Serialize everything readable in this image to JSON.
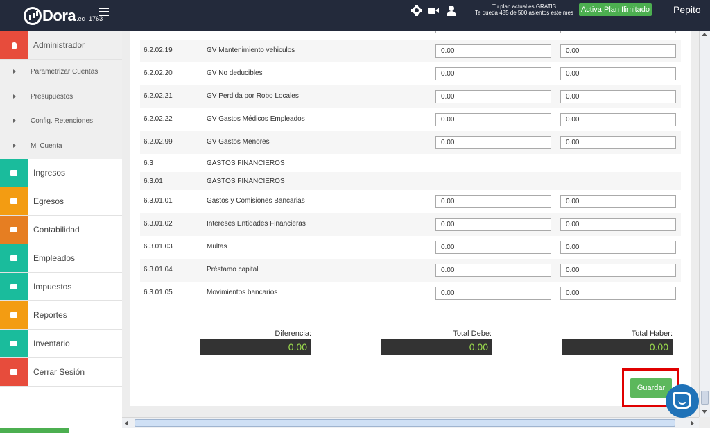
{
  "header": {
    "logo_text": "Dora",
    "logo_suffix": ".ec",
    "logo_number": "1763",
    "plan_line1": "Tu plan actual es GRATIS",
    "plan_line2": "Te queda 485 de 500 asientos este mes",
    "plan_button": "Activa Plan Ilimitado",
    "username": "Pepito"
  },
  "sidebar": {
    "admin_label": "Administrador",
    "admin_color": "#e74c3c",
    "subitems": [
      "Parametrizar Cuentas",
      "Presupuestos",
      "Config. Retenciones",
      "Mi Cuenta"
    ],
    "items": [
      {
        "label": "Ingresos",
        "color": "#1abc9c",
        "icon": "money-icon"
      },
      {
        "label": "Egresos",
        "color": "#f39c12",
        "icon": "sign-out-icon"
      },
      {
        "label": "Contabilidad",
        "color": "#e67e22",
        "icon": "briefcase-icon"
      },
      {
        "label": "Empleados",
        "color": "#1abc9c",
        "icon": "users-icon"
      },
      {
        "label": "Impuestos",
        "color": "#1abc9c",
        "icon": "balance-icon"
      },
      {
        "label": "Reportes",
        "color": "#f39c12",
        "icon": "chart-icon"
      },
      {
        "label": "Inventario",
        "color": "#1abc9c",
        "icon": "box-icon"
      },
      {
        "label": "Cerrar Sesión",
        "color": "#e74c3c",
        "icon": "power-icon"
      }
    ]
  },
  "rows": [
    {
      "code": "6.2.02.19",
      "name": "GV Mantenimiento vehiculos",
      "debe": "0.00",
      "haber": "0.00",
      "alt": true,
      "section": false
    },
    {
      "code": "6.2.02.20",
      "name": "GV No deducibles",
      "debe": "0.00",
      "haber": "0.00",
      "alt": false,
      "section": false
    },
    {
      "code": "6.2.02.21",
      "name": "GV Perdida por Robo Locales",
      "debe": "0.00",
      "haber": "0.00",
      "alt": true,
      "section": false
    },
    {
      "code": "6.2.02.22",
      "name": "GV Gastos Médicos Empleados",
      "debe": "0.00",
      "haber": "0.00",
      "alt": false,
      "section": false
    },
    {
      "code": "6.2.02.99",
      "name": "GV Gastos Menores",
      "debe": "0.00",
      "haber": "0.00",
      "alt": true,
      "section": false
    },
    {
      "code": "6.3",
      "name": "GASTOS FINANCIEROS",
      "alt": false,
      "section": true
    },
    {
      "code": "6.3.01",
      "name": "GASTOS FINANCIEROS",
      "alt": true,
      "section": true
    },
    {
      "code": "6.3.01.01",
      "name": "Gastos y Comisiones Bancarias",
      "debe": "0.00",
      "haber": "0.00",
      "alt": false,
      "section": false
    },
    {
      "code": "6.3.01.02",
      "name": "Intereses Entidades Financieras",
      "debe": "0.00",
      "haber": "0.00",
      "alt": true,
      "section": false
    },
    {
      "code": "6.3.01.03",
      "name": "Multas",
      "debe": "0.00",
      "haber": "0.00",
      "alt": false,
      "section": false
    },
    {
      "code": "6.3.01.04",
      "name": "Préstamo capital",
      "debe": "0.00",
      "haber": "0.00",
      "alt": true,
      "section": false
    },
    {
      "code": "6.3.01.05",
      "name": "Movimientos bancarios",
      "debe": "0.00",
      "haber": "0.00",
      "alt": false,
      "section": false
    }
  ],
  "partial_top_values": {
    "debe": "0.00",
    "haber": "0.00"
  },
  "totals": {
    "diferencia_label": "Diferencia:",
    "diferencia_value": "0.00",
    "debe_label": "Total Debe:",
    "debe_value": "0.00",
    "haber_label": "Total Haber:",
    "haber_value": "0.00"
  },
  "guardar_label": "Guardar"
}
